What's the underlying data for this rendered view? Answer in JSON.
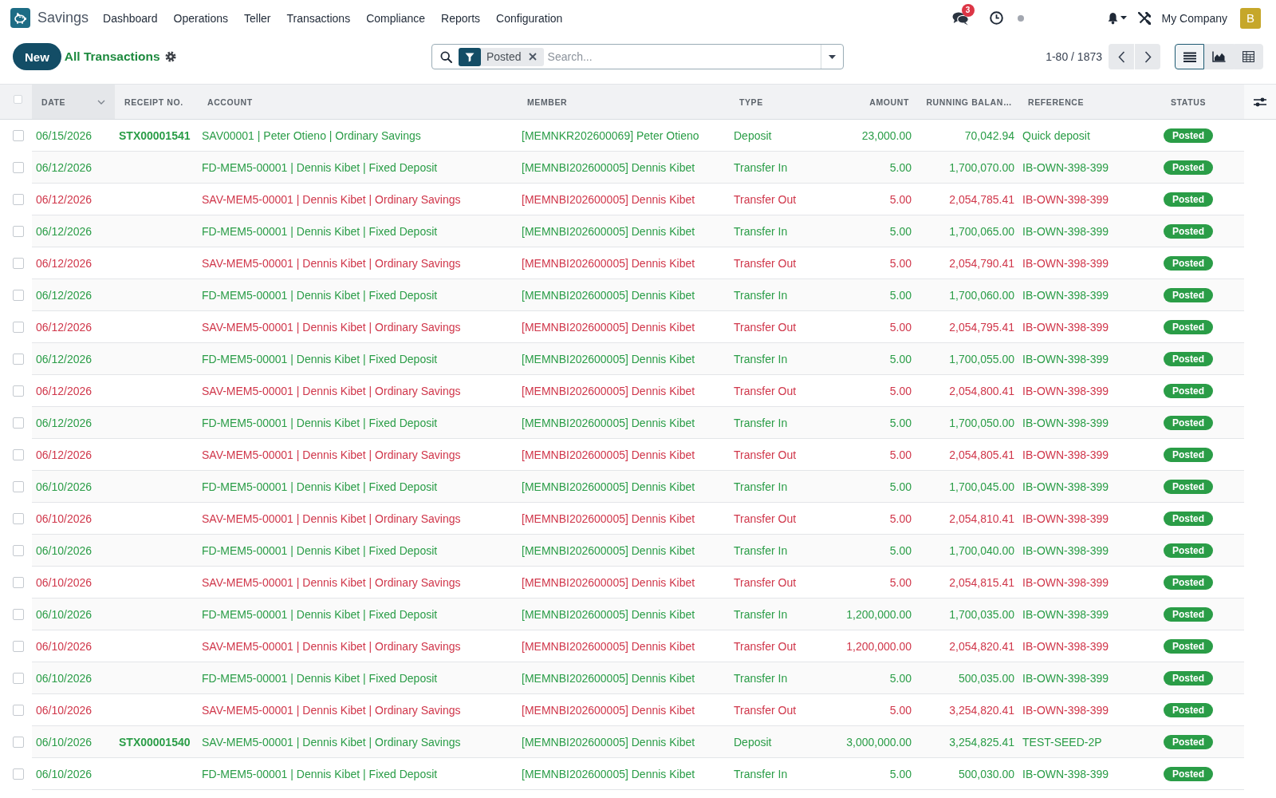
{
  "app": {
    "name": "Savings"
  },
  "menu": [
    "Dashboard",
    "Operations",
    "Teller",
    "Transactions",
    "Compliance",
    "Reports",
    "Configuration"
  ],
  "systray": {
    "message_count": "3",
    "company": "My Company",
    "avatar_letter": "B"
  },
  "control_panel": {
    "new_button": "New",
    "breadcrumb": "All Transactions",
    "search": {
      "facets": [
        {
          "kind": "filter",
          "label": "Posted"
        }
      ],
      "placeholder": "Search..."
    },
    "pager": "1-80 / 1873",
    "views": [
      {
        "kind": "list",
        "selected": true
      },
      {
        "kind": "graph",
        "selected": false
      },
      {
        "kind": "pivot",
        "selected": false
      }
    ]
  },
  "table": {
    "all_selected": false,
    "columns": [
      {
        "label": "DATE",
        "sorted": true
      },
      {
        "label": "RECEIPT NO.",
        "sorted": false
      },
      {
        "label": "ACCOUNT",
        "sorted": false
      },
      {
        "label": "MEMBER",
        "sorted": false
      },
      {
        "label": "TYPE",
        "sorted": false
      },
      {
        "label": "AMOUNT",
        "sorted": false
      },
      {
        "label": "RUNNING BALAN…",
        "sorted": false
      },
      {
        "label": "REFERENCE",
        "sorted": false
      },
      {
        "label": "STATUS",
        "sorted": false
      }
    ],
    "rows": [
      {
        "selected": false,
        "color": "#2a9d47",
        "date": "06/15/2026",
        "receipt": "STX00001541",
        "account": "SAV00001 | Peter Otieno | Ordinary Savings",
        "member": "[MEMNKR202600069] Peter Otieno",
        "type": "Deposit",
        "amount": "23,000.00",
        "balance": "70,042.94",
        "reference": "Quick deposit",
        "status": "Posted"
      },
      {
        "selected": false,
        "color": "#2a9d47",
        "date": "06/12/2026",
        "account": "FD-MEM5-00001 | Dennis Kibet | Fixed Deposit",
        "member": "[MEMNBI202600005] Dennis Kibet",
        "type": "Transfer In",
        "amount": "5.00",
        "balance": "1,700,070.00",
        "reference": "IB-OWN-398-399",
        "status": "Posted"
      },
      {
        "selected": false,
        "color": "#d0364a",
        "date": "06/12/2026",
        "account": "SAV-MEM5-00001 | Dennis Kibet | Ordinary Savings",
        "member": "[MEMNBI202600005] Dennis Kibet",
        "type": "Transfer Out",
        "amount": "5.00",
        "balance": "2,054,785.41",
        "reference": "IB-OWN-398-399",
        "status": "Posted"
      },
      {
        "selected": false,
        "color": "#2a9d47",
        "date": "06/12/2026",
        "account": "FD-MEM5-00001 | Dennis Kibet | Fixed Deposit",
        "member": "[MEMNBI202600005] Dennis Kibet",
        "type": "Transfer In",
        "amount": "5.00",
        "balance": "1,700,065.00",
        "reference": "IB-OWN-398-399",
        "status": "Posted"
      },
      {
        "selected": false,
        "color": "#d0364a",
        "date": "06/12/2026",
        "account": "SAV-MEM5-00001 | Dennis Kibet | Ordinary Savings",
        "member": "[MEMNBI202600005] Dennis Kibet",
        "type": "Transfer Out",
        "amount": "5.00",
        "balance": "2,054,790.41",
        "reference": "IB-OWN-398-399",
        "status": "Posted"
      },
      {
        "selected": false,
        "color": "#2a9d47",
        "date": "06/12/2026",
        "account": "FD-MEM5-00001 | Dennis Kibet | Fixed Deposit",
        "member": "[MEMNBI202600005] Dennis Kibet",
        "type": "Transfer In",
        "amount": "5.00",
        "balance": "1,700,060.00",
        "reference": "IB-OWN-398-399",
        "status": "Posted"
      },
      {
        "selected": false,
        "color": "#d0364a",
        "date": "06/12/2026",
        "account": "SAV-MEM5-00001 | Dennis Kibet | Ordinary Savings",
        "member": "[MEMNBI202600005] Dennis Kibet",
        "type": "Transfer Out",
        "amount": "5.00",
        "balance": "2,054,795.41",
        "reference": "IB-OWN-398-399",
        "status": "Posted"
      },
      {
        "selected": false,
        "color": "#2a9d47",
        "date": "06/12/2026",
        "account": "FD-MEM5-00001 | Dennis Kibet | Fixed Deposit",
        "member": "[MEMNBI202600005] Dennis Kibet",
        "type": "Transfer In",
        "amount": "5.00",
        "balance": "1,700,055.00",
        "reference": "IB-OWN-398-399",
        "status": "Posted"
      },
      {
        "selected": false,
        "color": "#d0364a",
        "date": "06/12/2026",
        "account": "SAV-MEM5-00001 | Dennis Kibet | Ordinary Savings",
        "member": "[MEMNBI202600005] Dennis Kibet",
        "type": "Transfer Out",
        "amount": "5.00",
        "balance": "2,054,800.41",
        "reference": "IB-OWN-398-399",
        "status": "Posted"
      },
      {
        "selected": false,
        "color": "#2a9d47",
        "date": "06/12/2026",
        "account": "FD-MEM5-00001 | Dennis Kibet | Fixed Deposit",
        "member": "[MEMNBI202600005] Dennis Kibet",
        "type": "Transfer In",
        "amount": "5.00",
        "balance": "1,700,050.00",
        "reference": "IB-OWN-398-399",
        "status": "Posted"
      },
      {
        "selected": false,
        "color": "#d0364a",
        "date": "06/12/2026",
        "account": "SAV-MEM5-00001 | Dennis Kibet | Ordinary Savings",
        "member": "[MEMNBI202600005] Dennis Kibet",
        "type": "Transfer Out",
        "amount": "5.00",
        "balance": "2,054,805.41",
        "reference": "IB-OWN-398-399",
        "status": "Posted"
      },
      {
        "selected": false,
        "color": "#2a9d47",
        "date": "06/10/2026",
        "account": "FD-MEM5-00001 | Dennis Kibet | Fixed Deposit",
        "member": "[MEMNBI202600005] Dennis Kibet",
        "type": "Transfer In",
        "amount": "5.00",
        "balance": "1,700,045.00",
        "reference": "IB-OWN-398-399",
        "status": "Posted"
      },
      {
        "selected": false,
        "color": "#d0364a",
        "date": "06/10/2026",
        "account": "SAV-MEM5-00001 | Dennis Kibet | Ordinary Savings",
        "member": "[MEMNBI202600005] Dennis Kibet",
        "type": "Transfer Out",
        "amount": "5.00",
        "balance": "2,054,810.41",
        "reference": "IB-OWN-398-399",
        "status": "Posted"
      },
      {
        "selected": false,
        "color": "#2a9d47",
        "date": "06/10/2026",
        "account": "FD-MEM5-00001 | Dennis Kibet | Fixed Deposit",
        "member": "[MEMNBI202600005] Dennis Kibet",
        "type": "Transfer In",
        "amount": "5.00",
        "balance": "1,700,040.00",
        "reference": "IB-OWN-398-399",
        "status": "Posted"
      },
      {
        "selected": false,
        "color": "#d0364a",
        "date": "06/10/2026",
        "account": "SAV-MEM5-00001 | Dennis Kibet | Ordinary Savings",
        "member": "[MEMNBI202600005] Dennis Kibet",
        "type": "Transfer Out",
        "amount": "5.00",
        "balance": "2,054,815.41",
        "reference": "IB-OWN-398-399",
        "status": "Posted"
      },
      {
        "selected": false,
        "color": "#2a9d47",
        "date": "06/10/2026",
        "account": "FD-MEM5-00001 | Dennis Kibet | Fixed Deposit",
        "member": "[MEMNBI202600005] Dennis Kibet",
        "type": "Transfer In",
        "amount": "1,200,000.00",
        "balance": "1,700,035.00",
        "reference": "IB-OWN-398-399",
        "status": "Posted"
      },
      {
        "selected": false,
        "color": "#d0364a",
        "date": "06/10/2026",
        "account": "SAV-MEM5-00001 | Dennis Kibet | Ordinary Savings",
        "member": "[MEMNBI202600005] Dennis Kibet",
        "type": "Transfer Out",
        "amount": "1,200,000.00",
        "balance": "2,054,820.41",
        "reference": "IB-OWN-398-399",
        "status": "Posted"
      },
      {
        "selected": false,
        "color": "#2a9d47",
        "date": "06/10/2026",
        "account": "FD-MEM5-00001 | Dennis Kibet | Fixed Deposit",
        "member": "[MEMNBI202600005] Dennis Kibet",
        "type": "Transfer In",
        "amount": "5.00",
        "balance": "500,035.00",
        "reference": "IB-OWN-398-399",
        "status": "Posted"
      },
      {
        "selected": false,
        "color": "#d0364a",
        "date": "06/10/2026",
        "account": "SAV-MEM5-00001 | Dennis Kibet | Ordinary Savings",
        "member": "[MEMNBI202600005] Dennis Kibet",
        "type": "Transfer Out",
        "amount": "5.00",
        "balance": "3,254,820.41",
        "reference": "IB-OWN-398-399",
        "status": "Posted"
      },
      {
        "selected": false,
        "color": "#2a9d47",
        "date": "06/10/2026",
        "receipt": "STX00001540",
        "account": "SAV-MEM5-00001 | Dennis Kibet | Ordinary Savings",
        "member": "[MEMNBI202600005] Dennis Kibet",
        "type": "Deposit",
        "amount": "3,000,000.00",
        "balance": "3,254,825.41",
        "reference": "TEST-SEED-2P",
        "status": "Posted"
      },
      {
        "selected": false,
        "color": "#2a9d47",
        "date": "06/10/2026",
        "account": "FD-MEM5-00001 | Dennis Kibet | Fixed Deposit",
        "member": "[MEMNBI202600005] Dennis Kibet",
        "type": "Transfer In",
        "amount": "5.00",
        "balance": "500,030.00",
        "reference": "IB-OWN-398-399",
        "status": "Posted"
      }
    ]
  }
}
